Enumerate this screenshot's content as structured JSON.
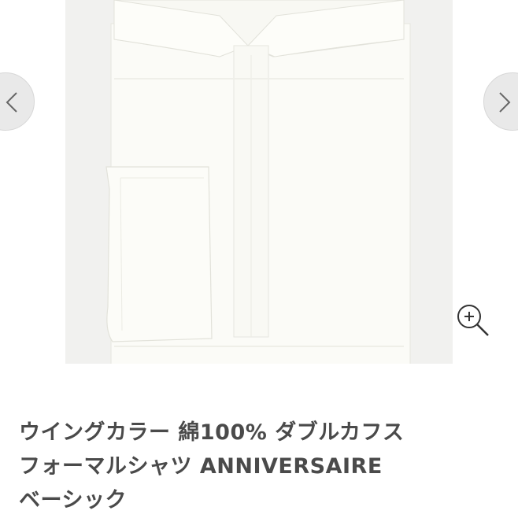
{
  "gallery": {
    "image_alt": "white wing collar double cuff formal shirt",
    "prev_icon": "chevron-left-icon",
    "next_icon": "chevron-right-icon",
    "zoom_icon": "zoom-in-icon"
  },
  "product": {
    "title_lines": [
      "ウイングカラー 綿100% ダブルカフス",
      "フォーマルシャツ ANNIVERSAIRE",
      "ベーシック"
    ]
  },
  "colors": {
    "photo_bg": "#f1f1ef",
    "shirt": "#fbfbf7",
    "title_text": "#4a4a4a",
    "nav_bg": "#e9e9e9"
  }
}
